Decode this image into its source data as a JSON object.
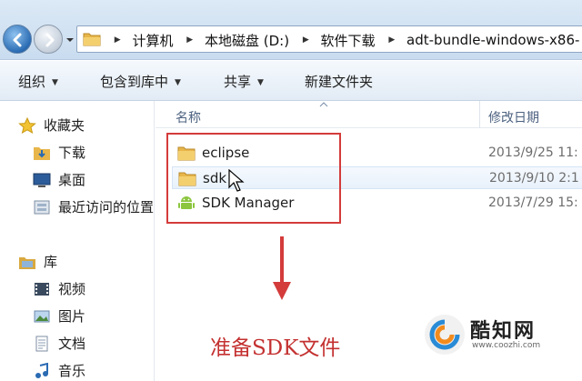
{
  "address": {
    "crumbs": [
      "计算机",
      "本地磁盘 (D:)",
      "软件下载",
      "adt-bundle-windows-x86-"
    ]
  },
  "toolbar": {
    "organize": "组织",
    "include_library": "包含到库中",
    "share": "共享",
    "new_folder": "新建文件夹"
  },
  "sidebar": {
    "favorites": "收藏夹",
    "downloads": "下载",
    "desktop": "桌面",
    "recent": "最近访问的位置",
    "libraries": "库",
    "videos": "视频",
    "pictures": "图片",
    "documents": "文档",
    "music": "音乐"
  },
  "columns": {
    "name": "名称",
    "date": "修改日期"
  },
  "files": [
    {
      "name": "eclipse",
      "date": "2013/9/25 11:",
      "icon": "folder-icon"
    },
    {
      "name": "sdk",
      "date": "2013/9/10 2:1",
      "icon": "folder-icon"
    },
    {
      "name": "SDK Manager",
      "date": "2013/7/29 15:",
      "icon": "android-icon"
    }
  ],
  "caption": "准备SDK文件",
  "watermark": {
    "brand": "酷知网",
    "url": "www.coozhi.com"
  },
  "colors": {
    "highlight_red": "#d43b3b",
    "caption_red": "#c43030",
    "folder_yellow": "#e8b64a"
  }
}
